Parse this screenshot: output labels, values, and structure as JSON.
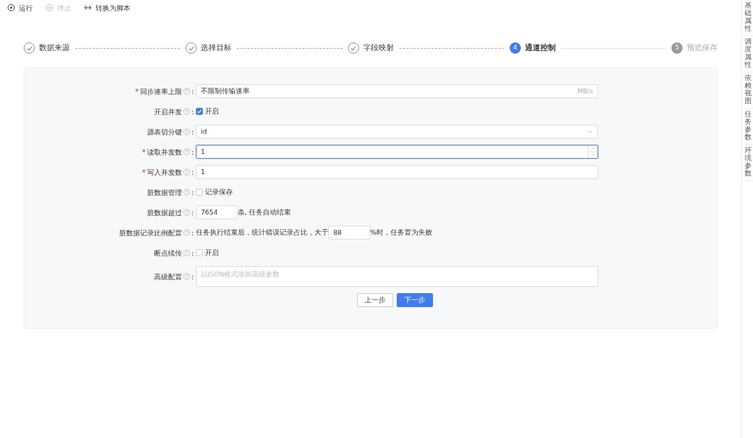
{
  "toolbar": [
    {
      "label": "运行",
      "disabled": false
    },
    {
      "label": "停止",
      "disabled": true
    },
    {
      "label": "转换为脚本",
      "disabled": false
    }
  ],
  "steps": [
    {
      "label": "数据来源",
      "done": true,
      "selected": false
    },
    {
      "label": "选择目标",
      "done": true,
      "selected": false
    },
    {
      "label": "字段映射",
      "done": true,
      "selected": false
    },
    {
      "label": "通道控制",
      "done": false,
      "selected": true,
      "number": "4"
    },
    {
      "label": "预览保存",
      "done": false,
      "selected": false,
      "number": "5"
    }
  ],
  "form": [
    {
      "kind": "input",
      "required_mark": "*",
      "label": "同步速率上限",
      "colon": ":",
      "value": "不限制传输速率",
      "suffix": "MB/s",
      "focused": false
    },
    {
      "kind": "checkbox",
      "label": "开启并发",
      "colon": ":",
      "checked": true,
      "option": "开启"
    },
    {
      "kind": "select",
      "label": "源表切分键",
      "colon": ":",
      "value": "id",
      "focused": false
    },
    {
      "kind": "number",
      "required_mark": "*",
      "label": "读取并发数",
      "colon": ":",
      "value": "1",
      "focused": true
    },
    {
      "kind": "number",
      "required_mark": "*",
      "label": "写入并发数",
      "colon": ":",
      "value": "1",
      "focused": false
    },
    {
      "kind": "checkbox",
      "label": "脏数据管理",
      "colon": ":",
      "checked": false,
      "option": "记录保存"
    },
    {
      "kind": "inline",
      "label": "脏数据超过",
      "colon": ":",
      "value": "7654",
      "text_after": "条, 任务自动结束",
      "focused": false
    },
    {
      "kind": "inline",
      "label": "脏数据记录比例配置",
      "colon": ":",
      "text_before": "任务执行结束后，统计错误记录占比，大于",
      "value": "88",
      "text_after": "%时，任务置为失败",
      "focused": false
    },
    {
      "kind": "checkbox",
      "label": "断点续传",
      "colon": ":",
      "checked": false,
      "option": "开启"
    },
    {
      "kind": "textarea",
      "label": "高级配置",
      "colon": ":",
      "placeholder": "以JSON格式添加高级参数",
      "focused": false
    }
  ],
  "buttons": [
    {
      "label": "上一步",
      "kind": "default"
    },
    {
      "label": "下一步",
      "kind": "primary"
    }
  ],
  "side_tabs": [
    "基础属性",
    "调度属性",
    "依赖视图",
    "任务参数",
    "环境参数"
  ]
}
